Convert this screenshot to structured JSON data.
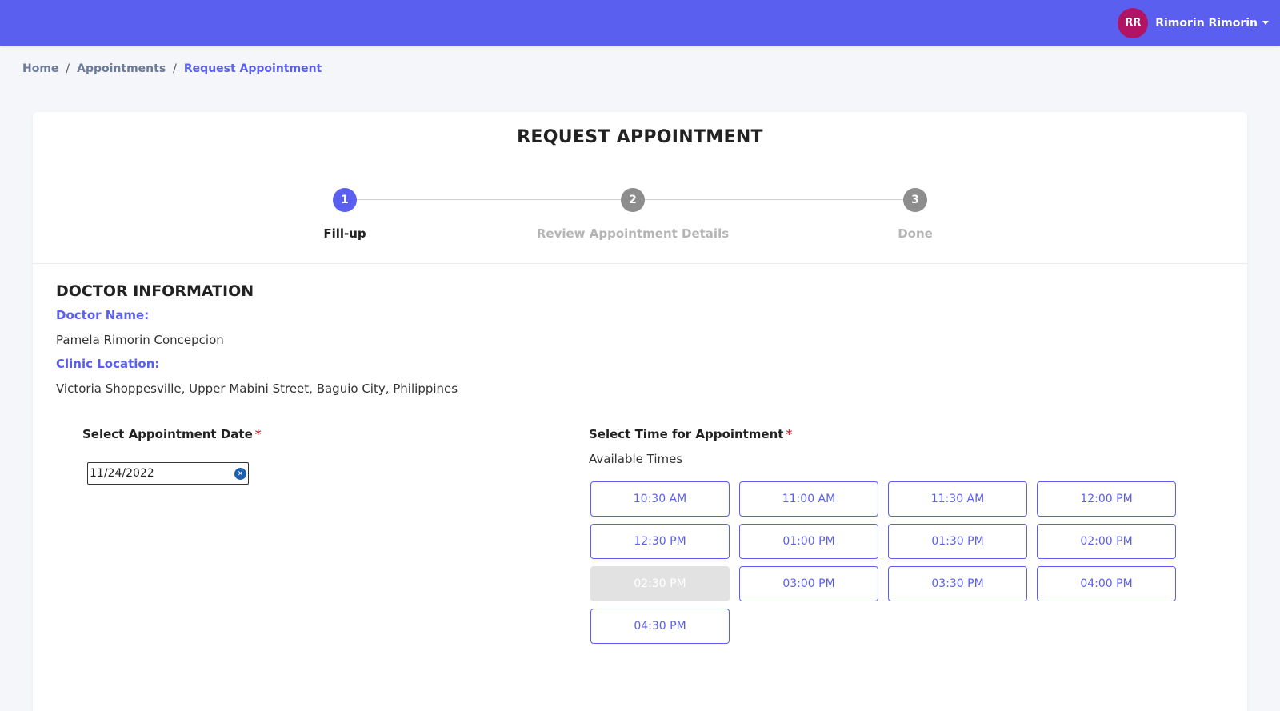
{
  "header": {
    "avatar_initials": "RR",
    "user_name": "Rimorin Rimorin",
    "bar_color": "#5b5fef",
    "avatar_color": "#b01463"
  },
  "breadcrumb": {
    "items": [
      "Home",
      "Appointments",
      "Request Appointment"
    ],
    "separator": "/"
  },
  "page": {
    "title": "REQUEST APPOINTMENT"
  },
  "stepper": {
    "steps": [
      {
        "number": "1",
        "label": "Fill-up",
        "state": "active"
      },
      {
        "number": "2",
        "label": "Review Appointment Details",
        "state": "inactive"
      },
      {
        "number": "3",
        "label": "Done",
        "state": "inactive"
      }
    ]
  },
  "doctor": {
    "section_title": "DOCTOR INFORMATION",
    "name_label": "Doctor Name:",
    "name": "Pamela Rimorin Concepcion",
    "location_label": "Clinic Location:",
    "location": "Victoria Shoppesville, Upper Mabini Street, Baguio City, Philippines"
  },
  "date_field": {
    "label": "Select Appointment Date",
    "required_marker": "*",
    "value": "11/24/2022",
    "clear_icon": "x-circle-icon"
  },
  "time_field": {
    "label": "Select Time for Appointment",
    "required_marker": "*",
    "subtitle": "Available Times",
    "slots": [
      {
        "time": "10:30 AM",
        "disabled": false
      },
      {
        "time": "11:00 AM",
        "disabled": false
      },
      {
        "time": "11:30 AM",
        "disabled": false
      },
      {
        "time": "12:00 PM",
        "disabled": false
      },
      {
        "time": "12:30 PM",
        "disabled": false
      },
      {
        "time": "01:00 PM",
        "disabled": false
      },
      {
        "time": "01:30 PM",
        "disabled": false
      },
      {
        "time": "02:00 PM",
        "disabled": false
      },
      {
        "time": "02:30 PM",
        "disabled": true
      },
      {
        "time": "03:00 PM",
        "disabled": false
      },
      {
        "time": "03:30 PM",
        "disabled": false
      },
      {
        "time": "04:00 PM",
        "disabled": false
      },
      {
        "time": "04:30 PM",
        "disabled": false
      }
    ]
  }
}
